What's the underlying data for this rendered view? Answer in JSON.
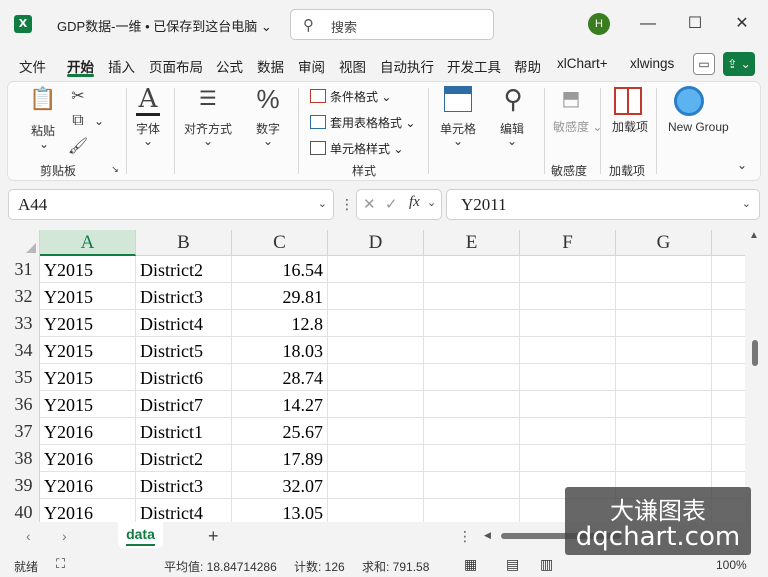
{
  "window": {
    "title": "GDP数据-一维 • 已保存到这台电脑",
    "search_placeholder": "搜索",
    "user_initial": "H",
    "app_icon": "excel-icon"
  },
  "menu": {
    "items": [
      "文件",
      "开始",
      "插入",
      "页面布局",
      "公式",
      "数据",
      "审阅",
      "视图",
      "自动执行",
      "开发工具",
      "帮助",
      "xlChart+",
      "xlwings"
    ],
    "active": "开始"
  },
  "ribbon": {
    "paste": "粘贴",
    "clipboard_group": "剪贴板",
    "font": "字体",
    "alignment": "对齐方式",
    "number": "数字",
    "conditional_format": "条件格式",
    "table_format": "套用表格格式",
    "cell_style": "单元格样式",
    "styles_group": "样式",
    "cells": "单元格",
    "edit": "编辑",
    "sensitivity": "敏感度",
    "sensitivity_group": "敏感度",
    "addins": "加载项",
    "addins_group": "加载项",
    "new_group": "New Group"
  },
  "formula_bar": {
    "name_box": "A44",
    "formula": "Y2011",
    "fx_label": "fx"
  },
  "grid": {
    "columns": [
      "A",
      "B",
      "C",
      "D",
      "E",
      "F",
      "G"
    ],
    "selected_column": "A",
    "rows": [
      {
        "num": "31",
        "a": "Y2015",
        "b": "District2",
        "c": "16.54"
      },
      {
        "num": "32",
        "a": "Y2015",
        "b": "District3",
        "c": "29.81"
      },
      {
        "num": "33",
        "a": "Y2015",
        "b": "District4",
        "c": "12.8"
      },
      {
        "num": "34",
        "a": "Y2015",
        "b": "District5",
        "c": "18.03"
      },
      {
        "num": "35",
        "a": "Y2015",
        "b": "District6",
        "c": "28.74"
      },
      {
        "num": "36",
        "a": "Y2015",
        "b": "District7",
        "c": "14.27"
      },
      {
        "num": "37",
        "a": "Y2016",
        "b": "District1",
        "c": "25.67"
      },
      {
        "num": "38",
        "a": "Y2016",
        "b": "District2",
        "c": "17.89"
      },
      {
        "num": "39",
        "a": "Y2016",
        "b": "District3",
        "c": "32.07"
      },
      {
        "num": "40",
        "a": "Y2016",
        "b": "District4",
        "c": "13.05"
      }
    ]
  },
  "sheets": {
    "tabs": [
      "data"
    ],
    "active": "data"
  },
  "status": {
    "ready": "就绪",
    "average": "平均值: 18.84714286",
    "count": "计数: 126",
    "sum": "求和: 791.58",
    "zoom": "100%"
  },
  "watermark": {
    "line1": "大谦图表",
    "line2": "dqchart.com"
  }
}
